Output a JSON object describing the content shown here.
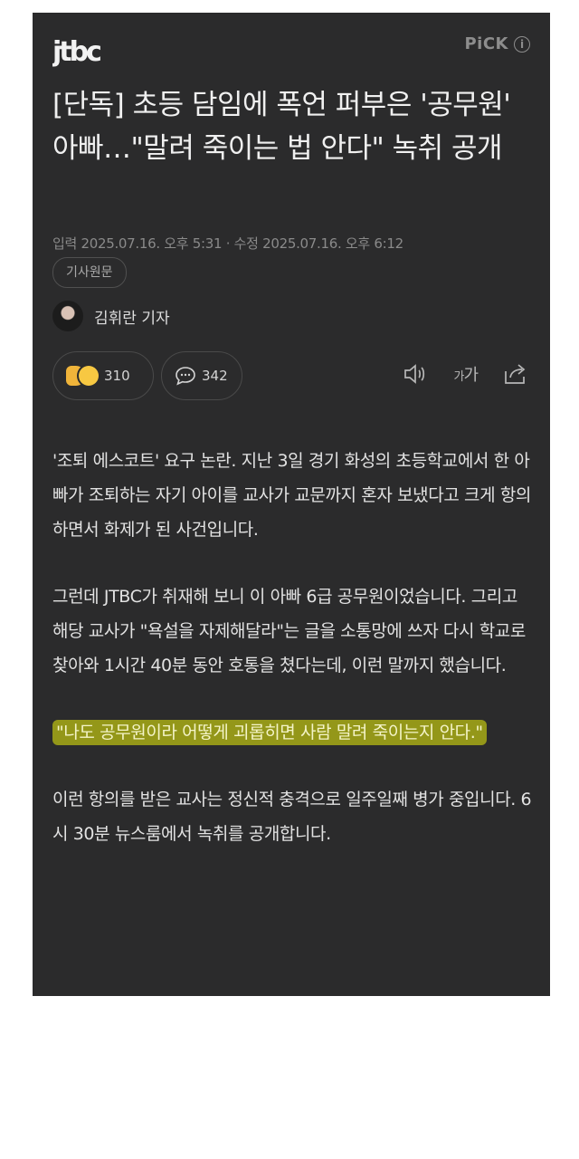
{
  "header": {
    "logo": "JTBC",
    "pick_label": "PiCK",
    "info_icon": "info-icon"
  },
  "article": {
    "headline": "[단독] 초등 담임에 폭언 퍼부은 '공무원' 아빠…\"말려 죽이는 법 안다\" 녹취 공개",
    "meta": "입력 2025.07.16. 오후 5:31 · 수정 2025.07.16. 오후 6:12",
    "source_tag": "기사원문",
    "author": "김휘란 기자",
    "reactions_count": "310",
    "comments_count": "342",
    "font_size_label": "가가",
    "paragraphs": [
      "'조퇴 에스코트' 요구 논란. 지난 3일 경기 화성의 초등학교에서 한 아빠가 조퇴하는 자기 아이를 교사가 교문까지 혼자 보냈다고 크게 항의하면서 화제가 된 사건입니다.",
      "그런데 JTBC가 취재해 보니 이 아빠 6급 공무원이었습니다. 그리고 해당 교사가 \"욕설을 자제해달라\"는 글을 소통망에 쓰자 다시 학교로 찾아와 1시간 40분 동안 호통을 쳤다는데, 이런 말까지 했습니다.",
      "\"나도 공무원이라 어떻게 괴롭히면 사람 말려 죽이는지 안다.\"",
      "이런 항의를 받은 교사는 정신적 충격으로 일주일째 병가 중입니다. 6시 30분 뉴스룸에서 녹취를 공개합니다."
    ]
  },
  "colors": {
    "background": "#2b2b2c",
    "highlight": "#b2b614"
  }
}
